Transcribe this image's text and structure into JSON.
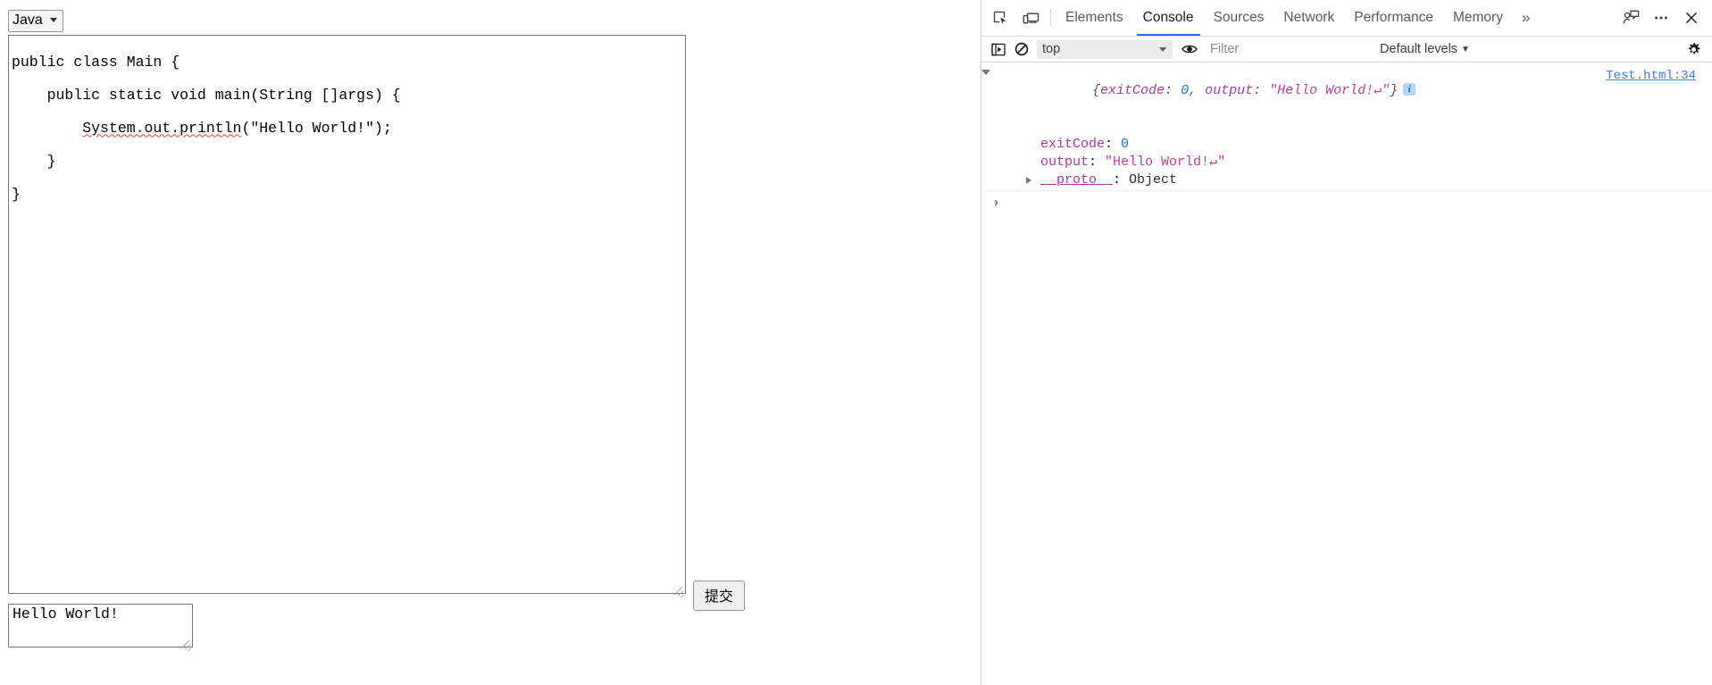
{
  "page": {
    "language_select": {
      "value": "Java",
      "options": [
        "Java"
      ]
    },
    "code_editor": {
      "lines": [
        "public class Main {",
        "    public static void main(String []args) {",
        "        System.out.println(\"Hello World!\");",
        "    }",
        "}"
      ],
      "value": "public class Main {\n    public static void main(String []args) {\n        System.out.println(\"Hello World!\");\n    }\n}",
      "misspelled_token": "System.out.println"
    },
    "submit_button_label": "提交",
    "output_area": {
      "value": "Hello World!"
    }
  },
  "devtools": {
    "tabs": [
      {
        "label": "Elements",
        "active": false
      },
      {
        "label": "Console",
        "active": true
      },
      {
        "label": "Sources",
        "active": false
      },
      {
        "label": "Network",
        "active": false
      },
      {
        "label": "Performance",
        "active": false
      },
      {
        "label": "Memory",
        "active": false
      }
    ],
    "tabs_overflow_label": "»",
    "toolbar": {
      "context_value": "top",
      "filter_placeholder": "Filter",
      "filter_value": "",
      "levels_label": "Default levels",
      "levels_caret": "▼"
    },
    "console": {
      "message": {
        "preview_open_brace": "{",
        "preview_key1": "exitCode",
        "preview_sep1": ": ",
        "preview_val1": "0",
        "preview_comma": ", ",
        "preview_key2": "output",
        "preview_sep2": ": ",
        "preview_val2": "\"Hello World!↵\"",
        "preview_close_brace": "}",
        "info_badge": "i",
        "source_link": "Test.html:34",
        "properties": [
          {
            "key": "exitCode",
            "separator": ": ",
            "value": "0",
            "value_type": "number"
          },
          {
            "key": "output",
            "separator": ": ",
            "value": "\"Hello World!↵\"",
            "value_type": "string"
          }
        ],
        "proto_key": "__proto__",
        "proto_separator": ": ",
        "proto_value": "Object"
      },
      "prompt_caret": "›",
      "prompt_value": "",
      "prompt_placeholder": ""
    },
    "colors": {
      "accent": "#1a73e8",
      "link": "#3b7dd8",
      "string": "#c6389c",
      "number": "#1c6fd8",
      "key": "#a23ba2",
      "badge_bg": "#b6d4f5"
    }
  }
}
